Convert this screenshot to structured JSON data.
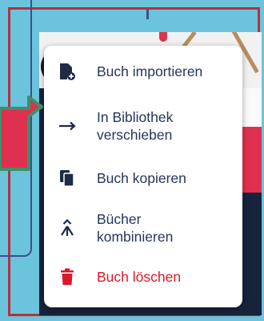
{
  "menu": {
    "items": [
      {
        "label": "Buch importieren",
        "icon": "book-add-icon"
      },
      {
        "label": "In Bibliothek\nverschieben",
        "icon": "arrow-right-icon"
      },
      {
        "label": "Buch kopieren",
        "icon": "copy-icon"
      },
      {
        "label": "Bücher\nkombinieren",
        "icon": "merge-icon"
      },
      {
        "label": "Buch löschen",
        "icon": "trash-icon"
      }
    ]
  },
  "colors": {
    "background": "#6cc4dc",
    "frame": "#b8303e",
    "menu_text": "#24365a",
    "danger": "#d9192c",
    "pointer_arrow": "#e0304f"
  }
}
